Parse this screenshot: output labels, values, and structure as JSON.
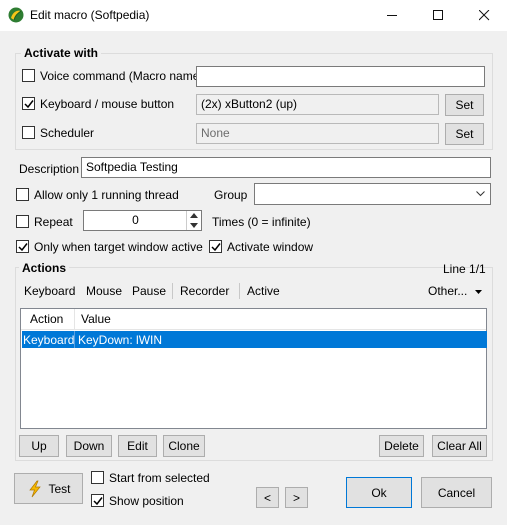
{
  "window": {
    "title": "Edit macro (Softpedia)",
    "minimize": "—",
    "maximize": "☐",
    "close": "✕"
  },
  "activate": {
    "title": "Activate with",
    "voice": {
      "label": "Voice command (Macro name)",
      "checked": false,
      "value": ""
    },
    "keyboard": {
      "label": "Keyboard / mouse button",
      "checked": true,
      "value": "(2x) xButton2 (up)",
      "set_label": "Set"
    },
    "scheduler": {
      "label": "Scheduler",
      "checked": false,
      "value": "None",
      "set_label": "Set"
    }
  },
  "description": {
    "label": "Description",
    "value": "Softpedia Testing"
  },
  "options": {
    "allow_one_thread": {
      "label": "Allow only 1 running thread",
      "checked": false
    },
    "group": {
      "label": "Group",
      "value": ""
    },
    "repeat": {
      "label": "Repeat",
      "checked": false,
      "value": "0"
    },
    "times_hint": "Times (0 = infinite)",
    "only_target": {
      "label": "Only when target window active",
      "checked": true
    },
    "activate_window": {
      "label": "Activate window",
      "checked": true
    }
  },
  "actions": {
    "title": "Actions",
    "line_info": "Line 1/1",
    "toolbar": [
      "Keyboard",
      "Mouse",
      "Pause",
      "Recorder",
      "Active"
    ],
    "other_label": "Other...",
    "columns": [
      "Action",
      "Value"
    ],
    "rows": [
      {
        "action": "Keyboard",
        "value": "KeyDown: lWIN",
        "selected": true
      }
    ],
    "buttons": {
      "up": "Up",
      "down": "Down",
      "edit": "Edit",
      "clone": "Clone",
      "delete": "Delete",
      "clear_all": "Clear All"
    }
  },
  "footer": {
    "test_label": "Test",
    "start_from_selected": {
      "label": "Start from selected",
      "checked": false
    },
    "show_position": {
      "label": "Show position",
      "checked": true
    },
    "prev": "<",
    "next": ">",
    "ok": "Ok",
    "cancel": "Cancel"
  },
  "colors": {
    "accent": "#0078d7",
    "window_bg": "#f0f0f0",
    "title_bg": "#ffffff"
  }
}
